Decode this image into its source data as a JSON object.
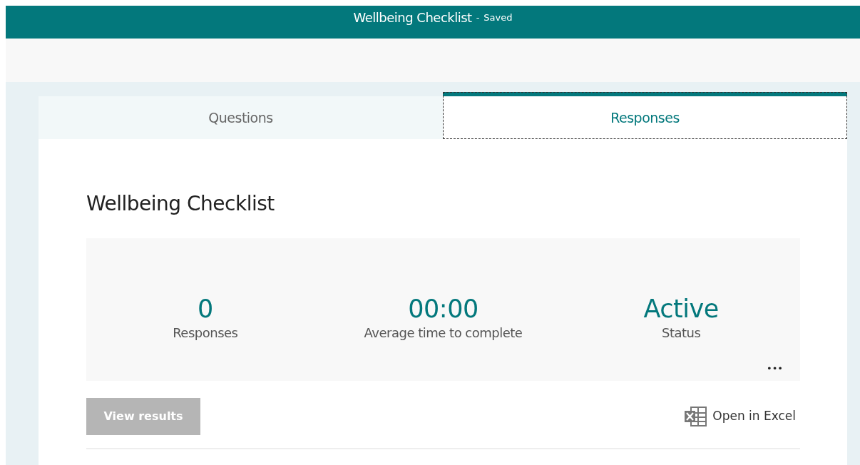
{
  "header": {
    "title": "Wellbeing Checklist",
    "separator": "-",
    "save_state": "Saved"
  },
  "tabs": [
    {
      "label": "Questions",
      "selected": false
    },
    {
      "label": "Responses",
      "selected": true
    }
  ],
  "form_title": "Wellbeing Checklist",
  "stats": [
    {
      "value": "0",
      "label": "Responses"
    },
    {
      "value": "00:00",
      "label": "Average time to complete"
    },
    {
      "value": "Active",
      "label": "Status"
    }
  ],
  "more_button": "•••",
  "view_results": {
    "label": "View results",
    "disabled": true
  },
  "open_in_excel": "Open in Excel"
}
